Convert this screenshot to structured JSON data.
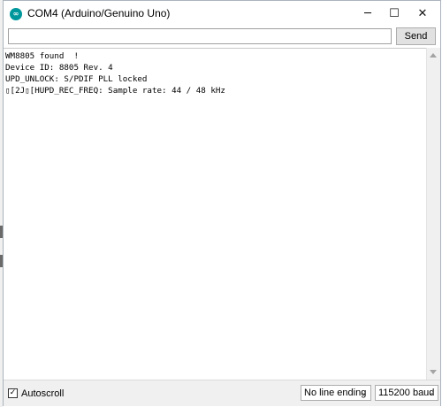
{
  "window": {
    "title": "COM4 (Arduino/Genuino Uno)",
    "app_icon_glyph": "∞",
    "controls": {
      "minimize": "─",
      "maximize": "☐",
      "close": "✕"
    }
  },
  "send": {
    "input_value": "",
    "button_label": "Send"
  },
  "output": {
    "lines": [
      "WM8805 found  !",
      "Device ID: 8805 Rev. 4",
      "UPD_UNLOCK: S/PDIF PLL locked",
      "▯[2J▯[HUPD_REC_FREQ: Sample rate: 44 / 48 kHz"
    ]
  },
  "footer": {
    "autoscroll_label": "Autoscroll",
    "autoscroll_checked": "✓",
    "line_ending": "No line ending",
    "baud": "115200 baud",
    "chevron": "⌄"
  },
  "colors": {
    "accent": "#00979c",
    "chrome": "#f0f0f0",
    "border": "#aab3bd"
  }
}
